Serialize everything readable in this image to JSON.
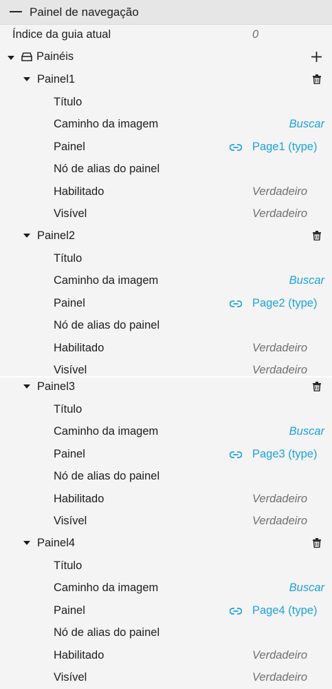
{
  "header": {
    "title": "Painel de navegação"
  },
  "current_tab_index": {
    "label": "Índice da guia atual",
    "value": "0"
  },
  "panels_group": {
    "label": "Painéis"
  },
  "panels": [
    {
      "name": "Painel1",
      "title_label": "Título",
      "image_path_label": "Caminho da imagem",
      "image_path_action": "Buscar",
      "panel_label": "Painel",
      "panel_value": "Page1 (type)",
      "alias_label": "Nó de alias do painel",
      "enabled_label": "Habilitado",
      "enabled_value": "Verdadeiro",
      "visible_label": "Visível",
      "visible_value": "Verdadeiro"
    },
    {
      "name": "Painel2",
      "title_label": "Título",
      "image_path_label": "Caminho da imagem",
      "image_path_action": "Buscar",
      "panel_label": "Painel",
      "panel_value": "Page2 (type)",
      "alias_label": "Nó de alias do painel",
      "enabled_label": "Habilitado",
      "enabled_value": "Verdadeiro",
      "visible_label": "Visível",
      "visible_value": "Verdadeiro"
    },
    {
      "name": "Painel3",
      "title_label": "Título",
      "image_path_label": "Caminho da imagem",
      "image_path_action": "Buscar",
      "panel_label": "Painel",
      "panel_value": "Page3 (type)",
      "alias_label": "Nó de alias do painel",
      "enabled_label": "Habilitado",
      "enabled_value": "Verdadeiro",
      "visible_label": "Visível",
      "visible_value": "Verdadeiro"
    },
    {
      "name": "Painel4",
      "title_label": "Título",
      "image_path_label": "Caminho da imagem",
      "image_path_action": "Buscar",
      "panel_label": "Painel",
      "panel_value": "Page4 (type)",
      "alias_label": "Nó de alias do painel",
      "enabled_label": "Habilitado",
      "enabled_value": "Verdadeiro",
      "visible_label": "Visível",
      "visible_value": "Verdadeiro"
    }
  ],
  "colors": {
    "link": "#1ba3dc",
    "muted": "#6f6f6f",
    "header_bg": "#e6e6e6",
    "panel_bg": "#f4f4f4"
  },
  "icons": {
    "collapse": "minus-icon",
    "expand": "caret-down-icon",
    "folder": "panels-icon",
    "add": "plus-icon",
    "delete": "trash-icon",
    "link": "link-icon"
  }
}
